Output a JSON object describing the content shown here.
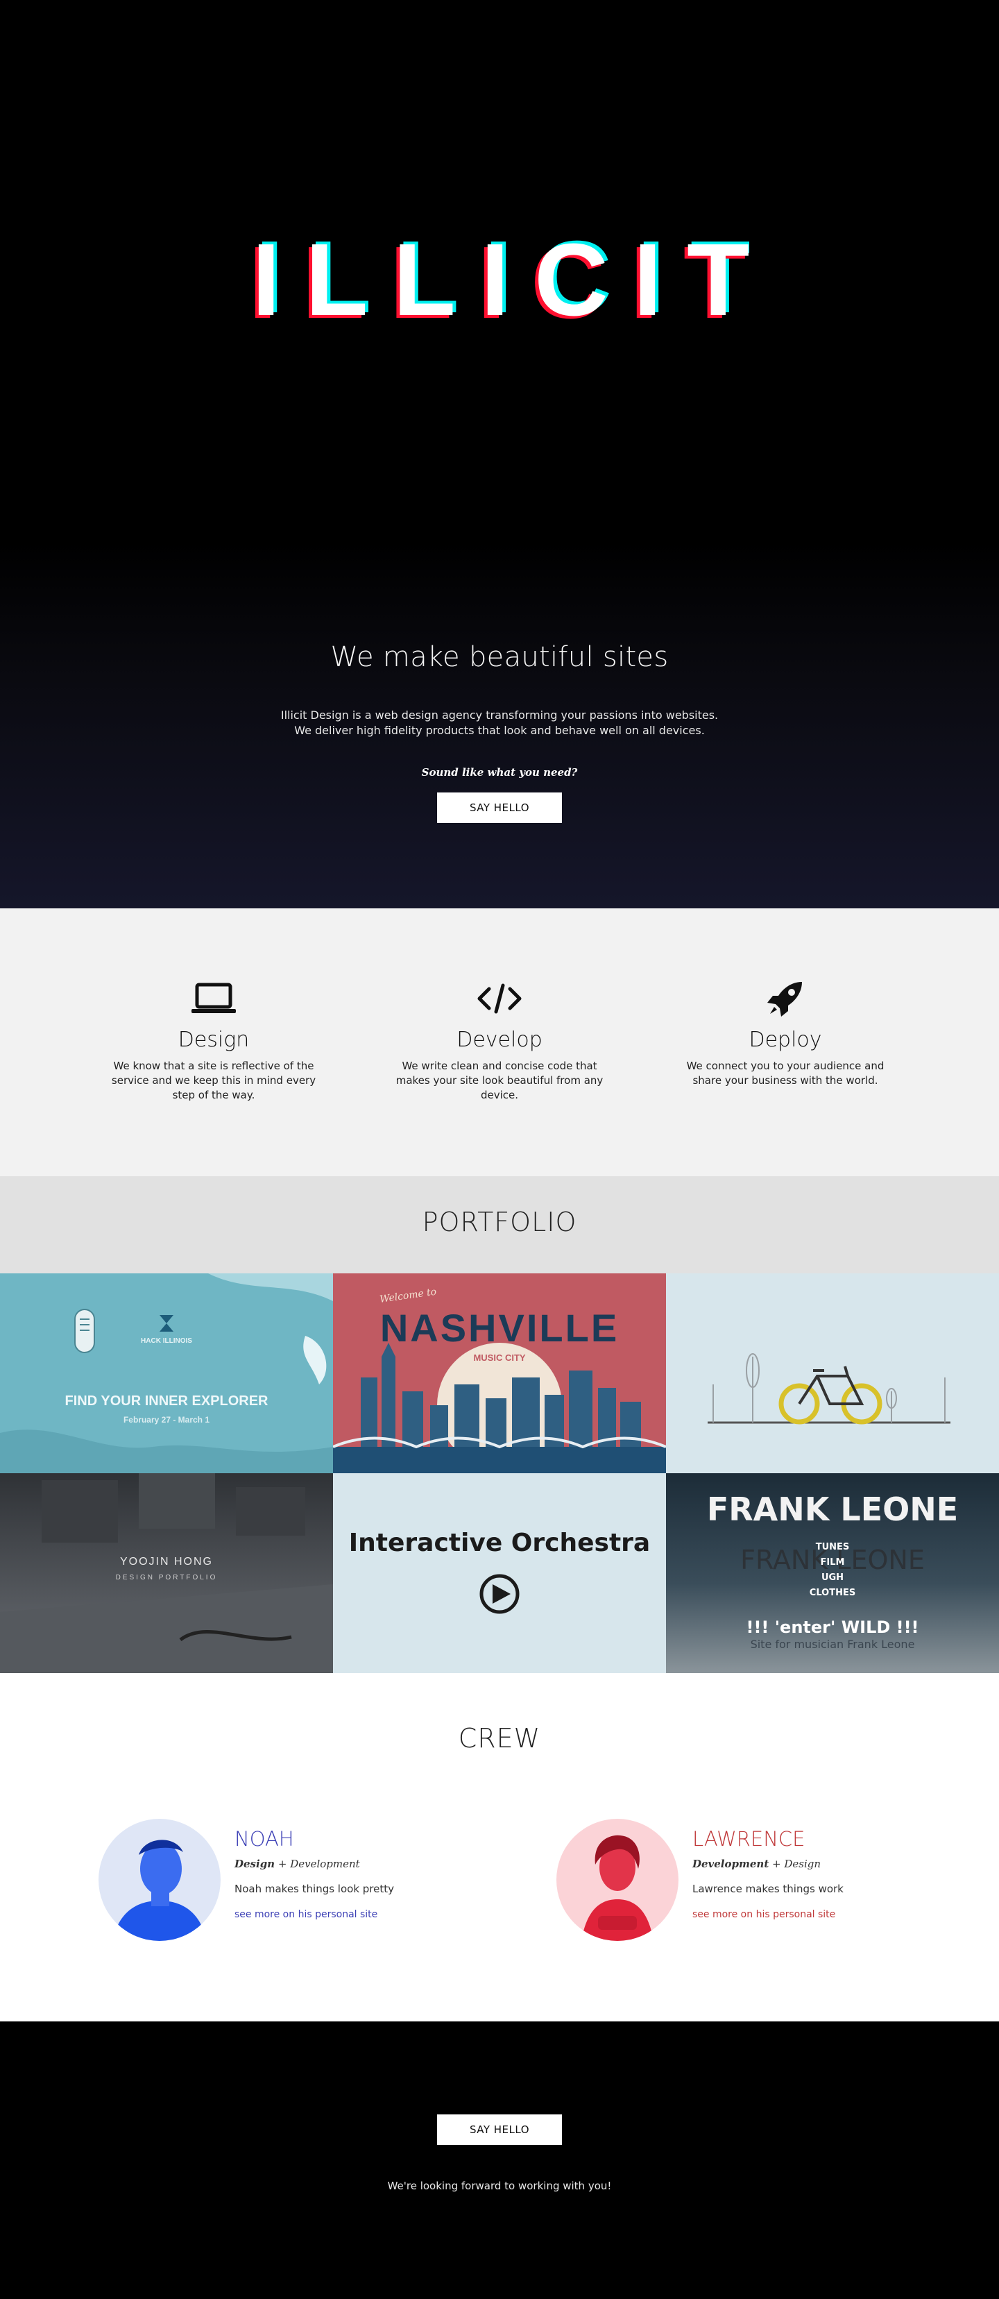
{
  "hero": {
    "logo_text": "ILLICIT",
    "tagline": "We make beautiful sites",
    "intro_line1": "Illicit Design is a web design agency transforming your passions into websites.",
    "intro_line2": "We deliver high fidelity products that look and behave well on all devices.",
    "ask": "Sound like what you need?",
    "cta_label": "SAY HELLO"
  },
  "services": [
    {
      "title": "Design",
      "icon": "laptop-icon",
      "desc": "We know that a site is reflective of the service and we keep this in mind every step of the way."
    },
    {
      "title": "Develop",
      "icon": "code-icon",
      "desc": "We write clean and concise code that makes your site look beautiful from any device."
    },
    {
      "title": "Deploy",
      "icon": "rocket-icon",
      "desc": "We connect you to your audience and share your business with the world."
    }
  ],
  "portfolio": {
    "heading": "PORTFOLIO",
    "tiles": [
      {
        "name": "hackillinois",
        "brand": "HACK ILLINOIS",
        "headline": "FIND YOUR INNER EXPLORER",
        "dates": "February 27 - March 1",
        "bg": "#6fb6c4"
      },
      {
        "name": "nashville",
        "script": "Welcome to",
        "headline": "NASHVILLE",
        "sub": "MUSIC CITY",
        "bg": "#c05a62"
      },
      {
        "name": "bike",
        "bg": "#d7e6ec"
      },
      {
        "name": "yoojin",
        "headline": "YOOJIN HONG",
        "sub": "DESIGN PORTFOLIO",
        "bg": "#4a4d52"
      },
      {
        "name": "orchestra",
        "headline": "Interactive Orchestra",
        "bg": "#d7e6ec"
      },
      {
        "name": "frankleone",
        "headline": "FRANK LEONE",
        "ghost_title": "FRANK LEONE",
        "items": [
          "TUNES",
          "FILM",
          "UGH",
          "CLOTHES"
        ],
        "enter": "!!!  'enter' WILD  !!!",
        "caption": "Site for musician Frank Leone",
        "bg": "#20323f"
      }
    ]
  },
  "crew": {
    "heading": "CREW",
    "members": [
      {
        "name": "NOAH",
        "role_main": "Design",
        "role_plus": "+ Development",
        "desc": "Noah makes things look pretty",
        "link": "see more on his personal site",
        "accent": "#3b3fb5"
      },
      {
        "name": "LAWRENCE",
        "role_main": "Development",
        "role_plus": "+ Design",
        "desc": "Lawrence makes things work",
        "link": "see more on his personal site",
        "accent": "#c0393a"
      }
    ]
  },
  "footer": {
    "cta_label": "SAY HELLO",
    "closing": "We're looking forward to working with you!"
  }
}
